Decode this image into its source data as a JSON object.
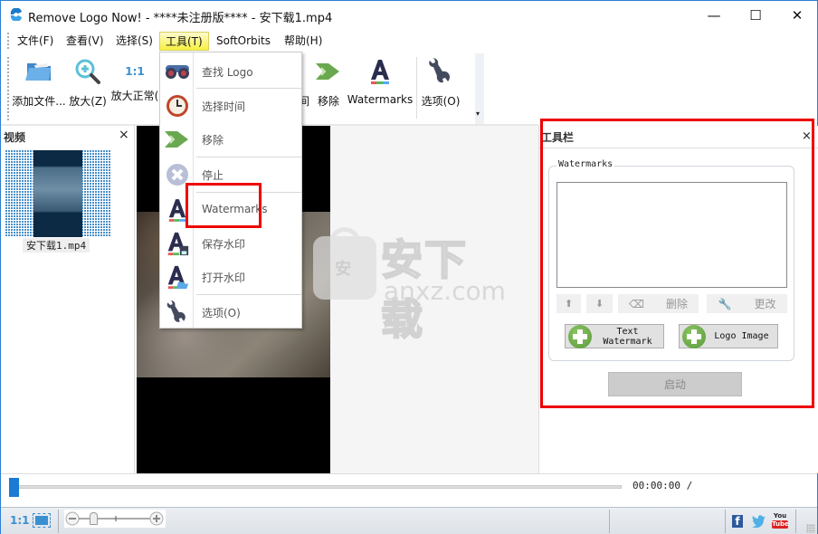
{
  "window": {
    "title": "Remove Logo Now! - ****未注册版**** - 安下载1.mp4",
    "minimize": "—",
    "maximize": "☐",
    "close": "✕"
  },
  "menu": {
    "items": [
      {
        "label": "文件(F)"
      },
      {
        "label": "查看(V)"
      },
      {
        "label": "选择(S)"
      },
      {
        "label": "工具(T)",
        "active": true
      },
      {
        "label": "SoftOrbits"
      },
      {
        "label": "帮助(H)"
      }
    ]
  },
  "toolbar": {
    "add_files": "添加文件...",
    "zoom_in": "放大(Z)",
    "zoom_normal": "放大正常(",
    "zoom_normal_icon": "1:1",
    "time_partial": "间",
    "remove": "移除",
    "watermarks": "Watermarks",
    "options": "选项(O)",
    "overflow": "▾"
  },
  "tools_menu": {
    "items": [
      {
        "label": "查找 Logo",
        "icon": "binoculars-icon"
      },
      {
        "label": "选择时间",
        "icon": "clock-icon"
      },
      {
        "label": "移除",
        "icon": "arrow-right-icon"
      },
      {
        "label": "停止",
        "icon": "stop-icon"
      },
      {
        "label": "Watermarks",
        "icon": "text-a-icon"
      },
      {
        "label": "保存水印",
        "icon": "save-watermark-icon"
      },
      {
        "label": "打开水印",
        "icon": "open-watermark-icon"
      },
      {
        "label": "选项(O)",
        "icon": "wrench-icon"
      }
    ]
  },
  "left_panel": {
    "title": "视频",
    "close": "×",
    "files": [
      {
        "name": "安下载1.mp4"
      }
    ]
  },
  "watermark_overlay": {
    "cn": "安下载",
    "domain": "anxz.com",
    "badge": "安"
  },
  "right_panel": {
    "title": "工具栏",
    "close": "×",
    "group_label": "Watermarks",
    "delete": "删除",
    "change": "更改",
    "text_watermark_line1": "Text",
    "text_watermark_line2": "Watermark",
    "logo_image": "Logo Image",
    "start": "启动"
  },
  "timeline": {
    "time": "00:00:00 /",
    "progress": 0
  },
  "statusbar": {
    "ratio": "1:1",
    "zoom_level": 0.2,
    "social": [
      "facebook",
      "twitter",
      "youtube"
    ],
    "yt_top": "You",
    "yt_bottom": "Tube",
    "fb": "f"
  },
  "colors": {
    "accent": "#1a7ad4",
    "highlight_red": "#e00000",
    "menu_active": "#f7f040",
    "green_plus": "#6aa84f"
  }
}
